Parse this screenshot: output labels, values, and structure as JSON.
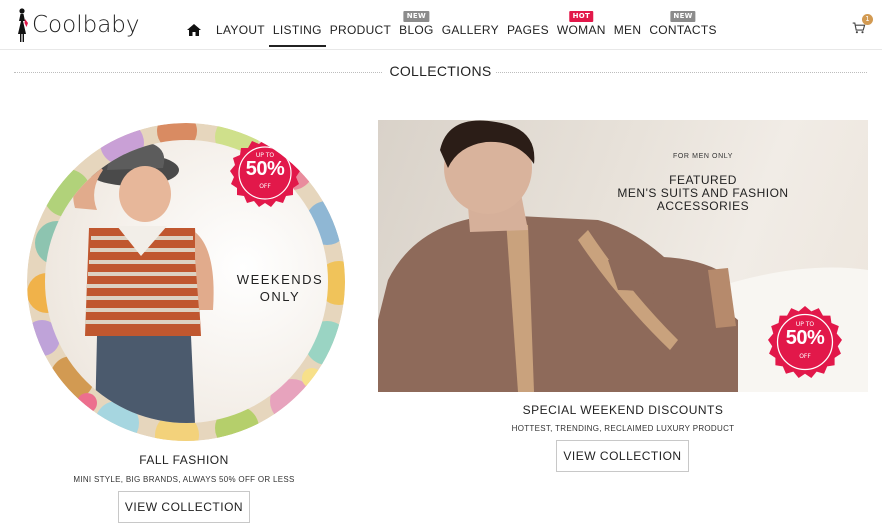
{
  "brand": {
    "name": "Coolbaby"
  },
  "nav": {
    "items": [
      {
        "label": "LAYOUT",
        "badge": ""
      },
      {
        "label": "LISTING",
        "badge": "",
        "active": true
      },
      {
        "label": "PRODUCT",
        "badge": ""
      },
      {
        "label": "BLOG",
        "badge": "NEW"
      },
      {
        "label": "GALLERY",
        "badge": ""
      },
      {
        "label": "PAGES",
        "badge": ""
      },
      {
        "label": "WOMAN",
        "badge": "HOT"
      },
      {
        "label": "MEN",
        "badge": ""
      },
      {
        "label": "CONTACTS",
        "badge": "NEW"
      }
    ]
  },
  "cart": {
    "count": "1"
  },
  "section": {
    "title": "COLLECTIONS"
  },
  "left_collection": {
    "banner_text_1": "WEEKENDS",
    "banner_text_2": "ONLY",
    "sale": {
      "up_to": "UP TO",
      "percent": "50%",
      "off": "OFF"
    },
    "title": "FALL FASHION",
    "subtitle": "MINI STYLE, BIG BRANDS, ALWAYS 50% OFF OR LESS",
    "button": "VIEW COLLECTION"
  },
  "right_collection": {
    "kicker": "FOR MEN ONLY",
    "featured_1": "FEATURED",
    "featured_2": "MEN'S SUITS AND FASHION",
    "featured_3": "ACCESSORIES",
    "sale": {
      "up_to": "UP TO",
      "percent": "50%",
      "off": "OFF"
    },
    "title": "SPECIAL WEEKEND DISCOUNTS",
    "subtitle": "HOTTEST, TRENDING, RECLAIMED LUXURY PRODUCT",
    "button": "VIEW COLLECTION"
  },
  "colors": {
    "sale_red": "#e2184a",
    "new_grey": "#8c8c8c",
    "cart_badge": "#d29a52"
  }
}
